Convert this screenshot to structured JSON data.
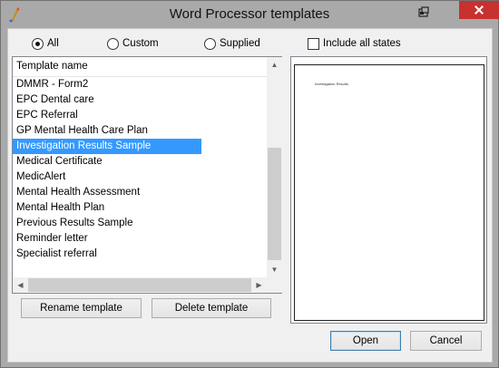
{
  "window": {
    "title": "Word Processor templates"
  },
  "filters": {
    "all_label": "All",
    "custom_label": "Custom",
    "supplied_label": "Supplied",
    "selected": "All",
    "include_all_states_label": "Include all states"
  },
  "list": {
    "header": "Template name",
    "items": [
      "DMMR - Form2",
      "EPC Dental care",
      "EPC Referral",
      "GP Mental Health Care Plan",
      "Investigation Results Sample",
      "Medical Certificate",
      "MedicAlert",
      "Mental Health Assessment",
      "Mental Health Plan",
      "Previous Results Sample",
      "Reminder letter",
      "Specialist referral"
    ],
    "selected_item": "Investigation Results Sample"
  },
  "buttons": {
    "rename": "Rename template",
    "delete": "Delete template",
    "open": "Open",
    "cancel": "Cancel"
  },
  "preview": {
    "text": "Investigation Results"
  },
  "icons": {
    "app": "feather-pen-icon",
    "restore": "restore-window-icon",
    "close": "close-icon",
    "scroll_up": "scroll-up-arrow-icon",
    "scroll_down": "scroll-down-arrow-icon",
    "scroll_left": "scroll-left-arrow-icon",
    "scroll_right": "scroll-right-arrow-icon"
  },
  "colors": {
    "selection": "#3399ff",
    "close_button": "#c7312f",
    "title_bar": "#a9a9a9"
  }
}
